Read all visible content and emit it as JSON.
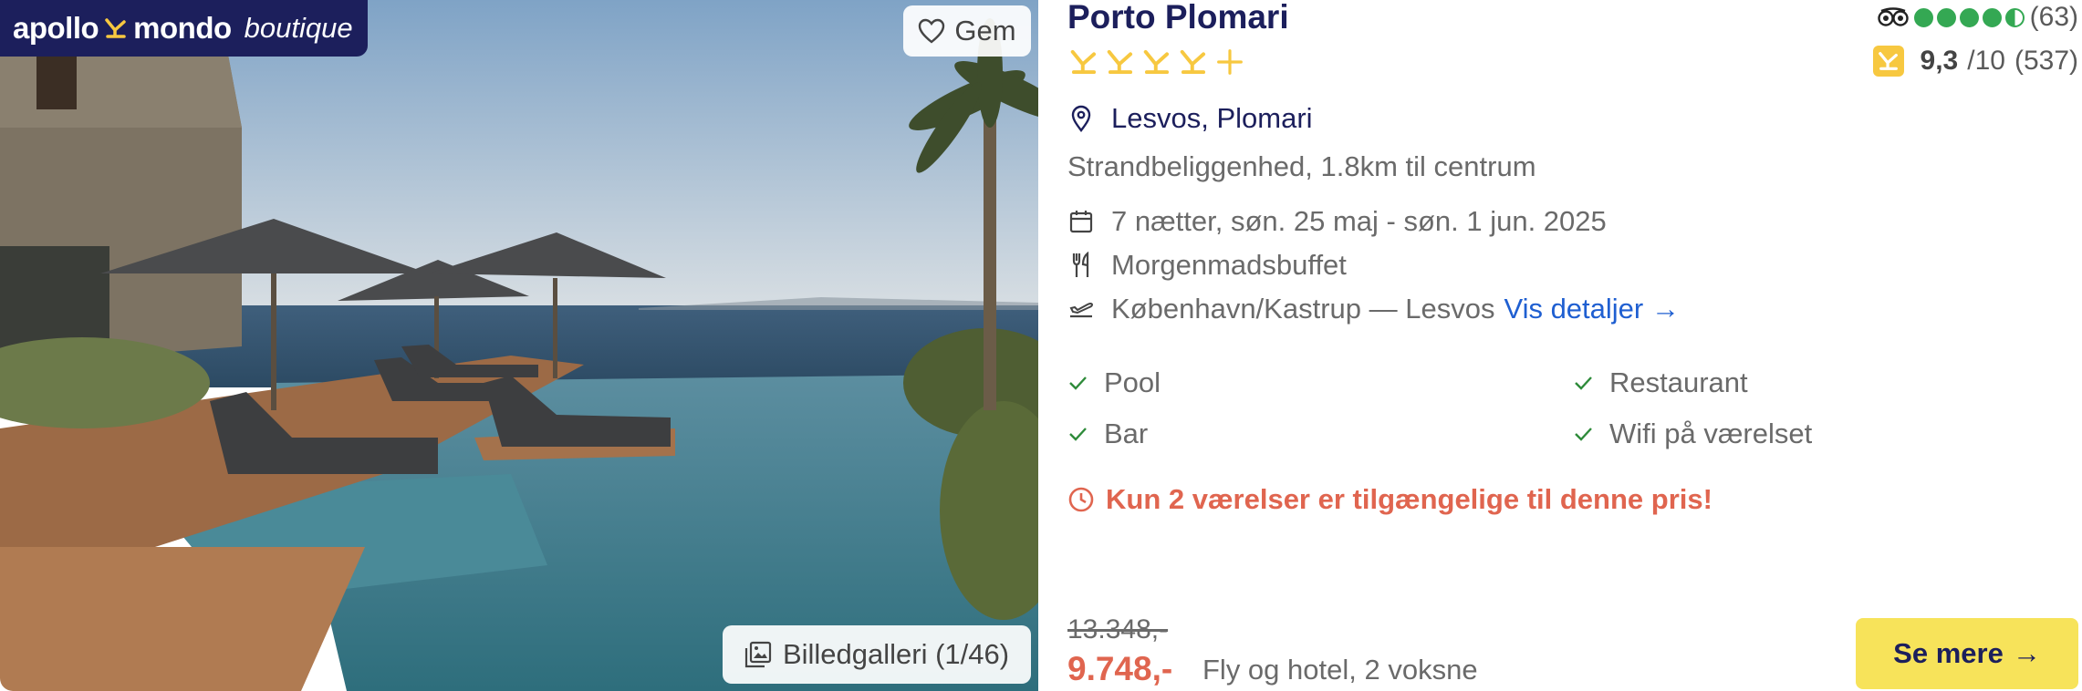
{
  "brand": {
    "part1": "apollo",
    "part2": "mondo",
    "part3": "boutique",
    "logo_icon": "apollo-sun-mark"
  },
  "image": {
    "save_label": "Gem",
    "save_icon": "heart-outline-icon",
    "gallery_label": "Billedgalleri (1/46)",
    "gallery_icon": "image-gallery-icon"
  },
  "hotel": {
    "name": "Porto Plomari",
    "stars": 4,
    "half_star": true,
    "location": "Lesvos, Plomari",
    "beach_info": "Strandbeliggenhed, 1.8km til centrum",
    "dates": "7 nætter, søn. 25 maj - søn. 1 jun. 2025",
    "meal_plan": "Morgenmadsbuffet",
    "route": "København/Kastrup — Lesvos",
    "details_link": "Vis detaljer →"
  },
  "tripadvisor": {
    "dots": 4.5,
    "count": "(63)"
  },
  "guest_rating": {
    "score": "9,3",
    "scale": "/10",
    "count": "(537)"
  },
  "facilities": [
    "Pool",
    "Restaurant",
    "Bar",
    "Wifi på værelset"
  ],
  "urgency": "Kun 2 værelser er tilgængelige til denne pris!",
  "pricing": {
    "old_price": "13.348,-",
    "price": "9.748,-",
    "note": "Fly og hotel, 2 voksne"
  },
  "cta": {
    "label": "Se mere",
    "arrow": "→"
  },
  "colors": {
    "navy": "#1c1f5c",
    "accent_yellow": "#f7c840",
    "cta_yellow": "#f7e35a",
    "urgent_red": "#e0654f",
    "link_blue": "#1f5fd1",
    "ta_green": "#34a853"
  }
}
